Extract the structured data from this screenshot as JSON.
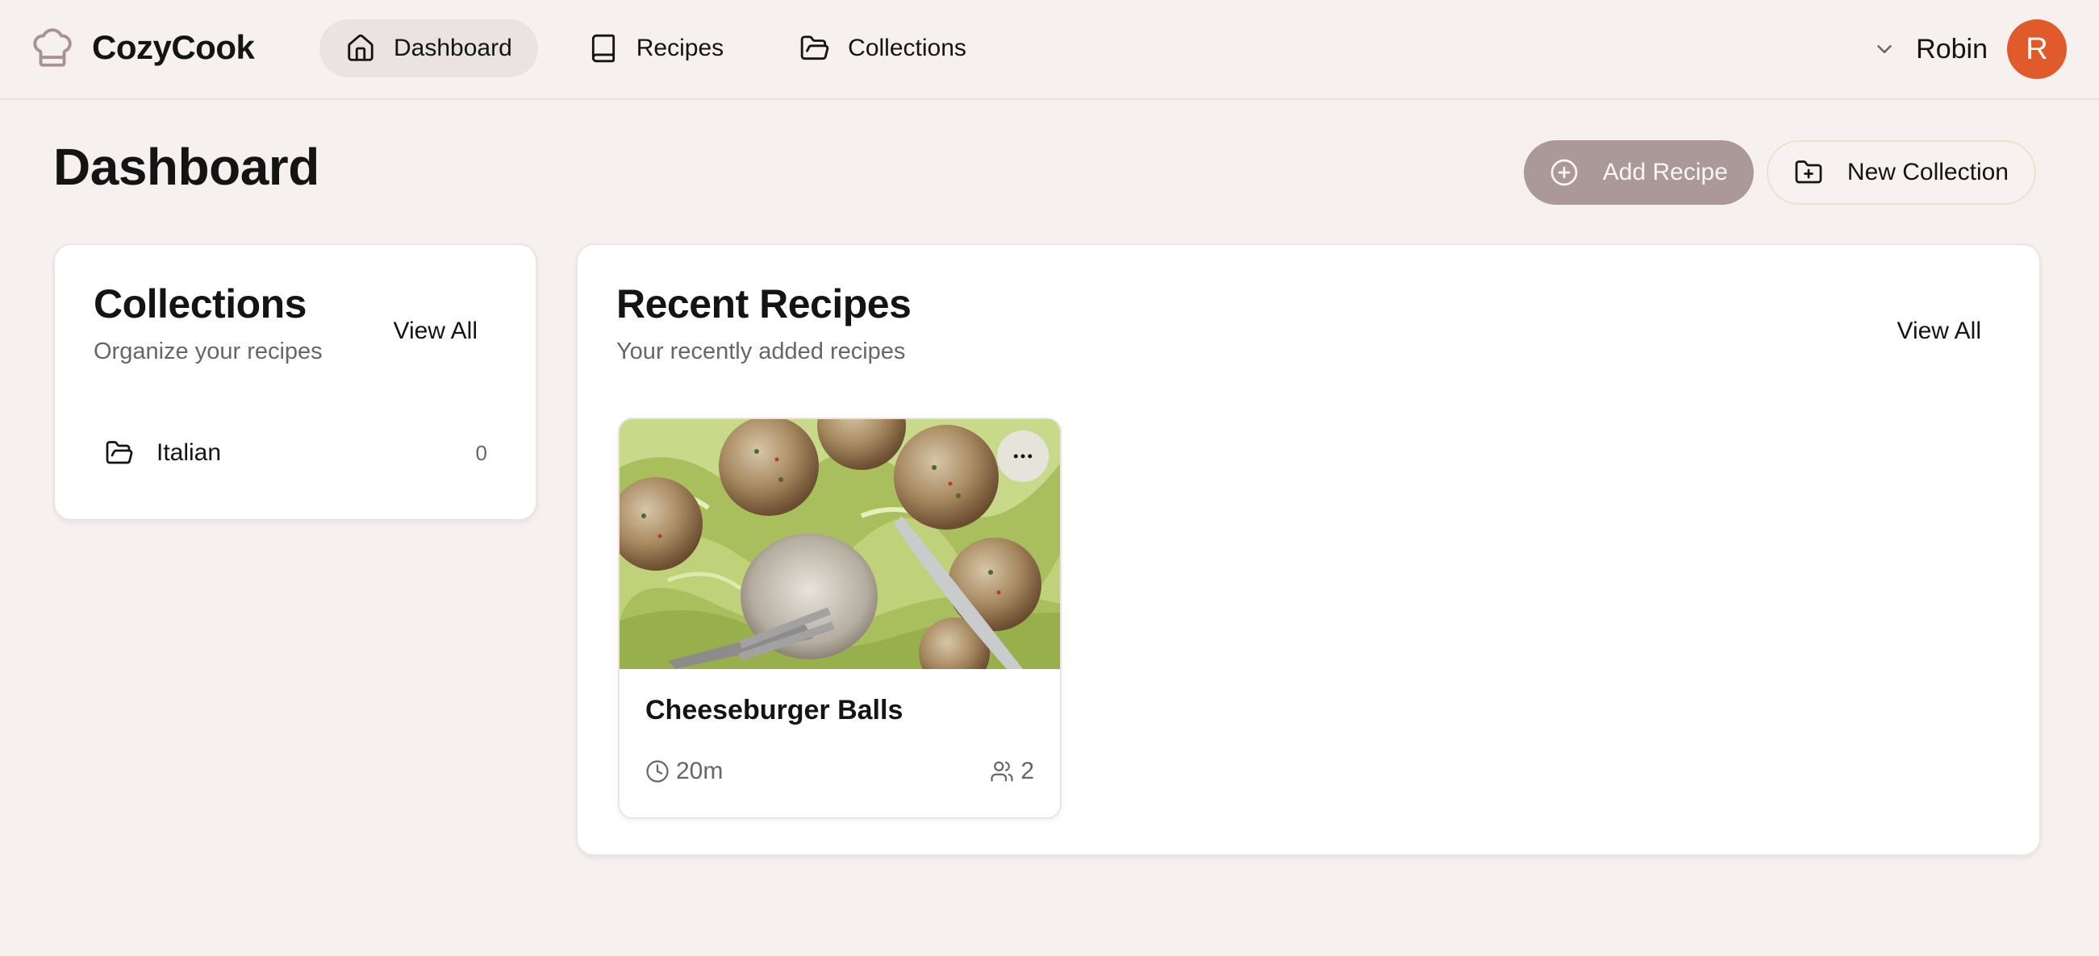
{
  "brand": {
    "name": "CozyCook",
    "logo_icon": "chef-hat-icon"
  },
  "nav": {
    "items": [
      {
        "label": "Dashboard",
        "icon": "home-icon",
        "active": true
      },
      {
        "label": "Recipes",
        "icon": "book-icon",
        "active": false
      },
      {
        "label": "Collections",
        "icon": "folder-open-icon",
        "active": false
      }
    ]
  },
  "user": {
    "name": "Robin",
    "initial": "R",
    "avatar_color": "#e05a2c"
  },
  "page": {
    "title": "Dashboard"
  },
  "actions": {
    "add_recipe": "Add Recipe",
    "new_collection": "New Collection"
  },
  "collections": {
    "title": "Collections",
    "subtitle": "Organize your recipes",
    "view_all": "View All",
    "items": [
      {
        "name": "Italian",
        "count": "0"
      }
    ]
  },
  "recent": {
    "title": "Recent Recipes",
    "subtitle": "Your recently added recipes",
    "view_all": "View All",
    "recipes": [
      {
        "title": "Cheeseburger Balls",
        "time": "20m",
        "servings": "2"
      }
    ]
  },
  "colors": {
    "background": "#f6f0ef",
    "primary_button": "#ab9898",
    "nav_active": "#ebe3e3",
    "avatar": "#e05a2c"
  }
}
